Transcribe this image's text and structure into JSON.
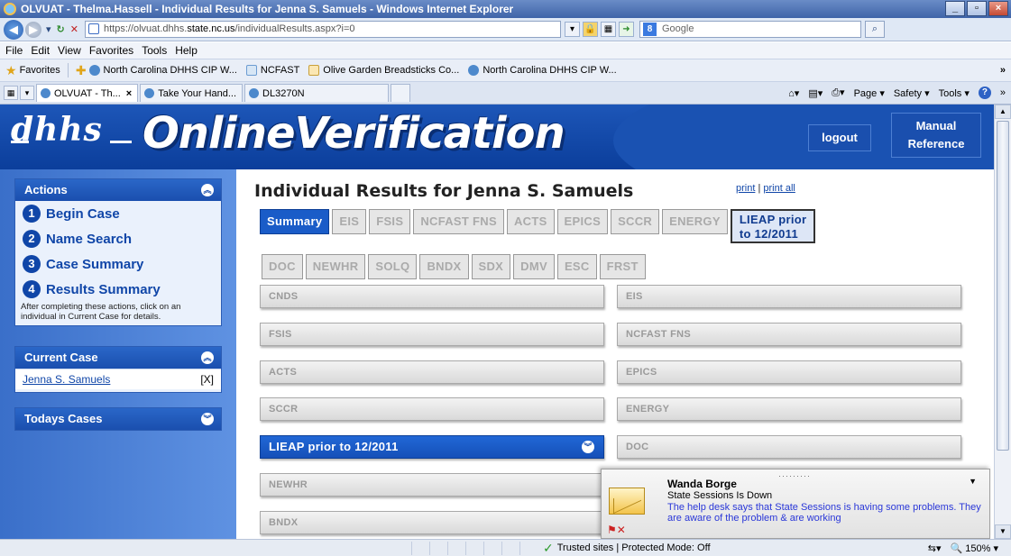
{
  "window": {
    "title": "OLVUAT - Thelma.Hassell - Individual Results for Jenna S. Samuels - Windows Internet Explorer",
    "url_prefix": "https://olvuat.dhhs.",
    "url_domain": "state.nc.us",
    "url_suffix": "/individualResults.aspx?i=0",
    "search_placeholder": "Google"
  },
  "menu": [
    "File",
    "Edit",
    "View",
    "Favorites",
    "Tools",
    "Help"
  ],
  "favorites": {
    "label": "Favorites",
    "items": [
      "North Carolina DHHS CIP W...",
      "NCFAST",
      "Olive Garden Breadsticks Co...",
      "North Carolina DHHS CIP W..."
    ]
  },
  "tabs": [
    "OLVUAT - Th...",
    "Take Your Hand...",
    "DL3270N"
  ],
  "command_bar": [
    "Page",
    "Safety",
    "Tools"
  ],
  "header": {
    "logo": "dhhs",
    "title": "OnlineVerification",
    "logout": "logout",
    "manual_line1": "Manual",
    "manual_line2": "Reference"
  },
  "actions": {
    "title": "Actions",
    "steps": [
      {
        "num": "1",
        "label": "Begin Case"
      },
      {
        "num": "2",
        "label": "Name Search"
      },
      {
        "num": "3",
        "label": "Case Summary"
      },
      {
        "num": "4",
        "label": "Results Summary"
      }
    ],
    "note": "After completing these actions, click on an individual in Current Case for details."
  },
  "current_case": {
    "title": "Current Case",
    "name": "Jenna S. Samuels",
    "remove": "[X]"
  },
  "todays_cases": {
    "title": "Todays Cases"
  },
  "page": {
    "title": "Individual Results for Jenna S. Samuels",
    "print": "print",
    "print_all": "print all",
    "divider": "|"
  },
  "source_tabs_row1": [
    "Summary",
    "EIS",
    "FSIS",
    "NCFAST FNS",
    "ACTS",
    "EPICS",
    "SCCR",
    "ENERGY"
  ],
  "source_tab_tall_1": "LIEAP prior",
  "source_tab_tall_2": "to 12/2011",
  "source_tabs_row2": [
    "DOC",
    "NEWHR",
    "SOLQ",
    "BNDX",
    "SDX",
    "DMV",
    "ESC",
    "FRST"
  ],
  "result_bars": {
    "left": [
      "CNDS",
      "FSIS",
      "ACTS",
      "SCCR",
      "LIEAP prior to 12/2011",
      "NEWHR",
      "BNDX"
    ],
    "right": [
      "EIS",
      "NCFAST FNS",
      "EPICS",
      "ENERGY",
      "DOC"
    ]
  },
  "notification": {
    "sender": "Wanda Borge",
    "subject": "State Sessions Is Down",
    "body": "The help desk says that State Sessions is having some problems.  They are aware of the problem & are working"
  },
  "status": {
    "zone": "Trusted sites | Protected Mode: Off",
    "zoom": "150%"
  },
  "colors": {
    "brand_blue": "#1046a8",
    "active_tab": "#1a5cc8",
    "link_text": "#2a37d8"
  }
}
